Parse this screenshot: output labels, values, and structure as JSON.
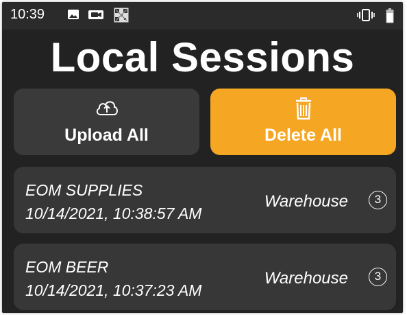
{
  "status_bar": {
    "time": "10:39",
    "icons": [
      "image-icon",
      "camera-icon",
      "qr-code-icon",
      "vibrate-icon",
      "battery-icon"
    ]
  },
  "page": {
    "title": "Local Sessions"
  },
  "actions": {
    "upload_label": "Upload All",
    "upload_icon": "cloud-upload-icon",
    "delete_label": "Delete All",
    "delete_icon": "trash-icon"
  },
  "colors": {
    "background": "#222222",
    "card": "#373737",
    "accent": "#f5a623"
  },
  "sessions": [
    {
      "name": "EOM SUPPLIES",
      "datetime": "10/14/2021, 10:38:57 AM",
      "location": "Warehouse",
      "count": "3"
    },
    {
      "name": "EOM BEER",
      "datetime": "10/14/2021, 10:37:23 AM",
      "location": "Warehouse",
      "count": "3"
    }
  ]
}
